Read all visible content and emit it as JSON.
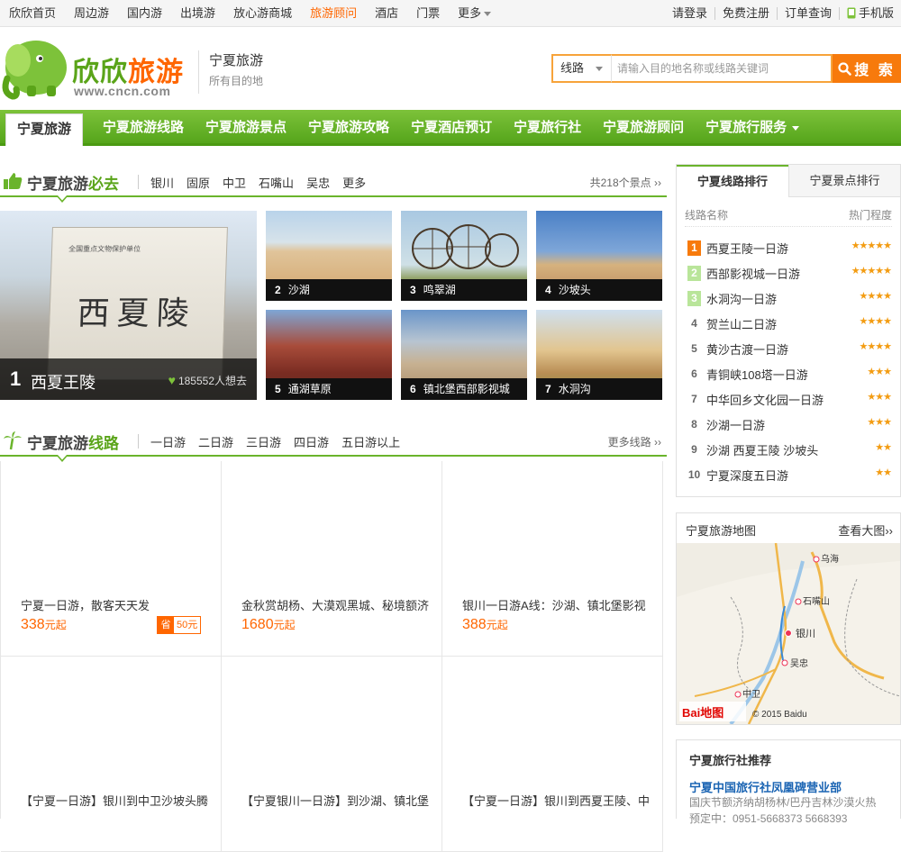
{
  "topbar": {
    "left": [
      "欣欣首页",
      "周边游",
      "国内游",
      "出境游",
      "放心游商城",
      "旅游顾问",
      "酒店",
      "门票",
      "更多"
    ],
    "active_index": 5,
    "right": [
      "请登录",
      "免费注册",
      "订单查询",
      "手机版"
    ]
  },
  "logo": {
    "name_a": "欣欣",
    "name_b": "旅游",
    "url": "www.cncn.com"
  },
  "city": {
    "title": "宁夏旅游",
    "subtitle": "所有目的地"
  },
  "search": {
    "select": "线路",
    "placeholder": "请输入目的地名称或线路关键词",
    "button": "搜 索"
  },
  "nav": [
    "宁夏旅游",
    "宁夏旅游线路",
    "宁夏旅游景点",
    "宁夏旅游攻略",
    "宁夏酒店预订",
    "宁夏旅行社",
    "宁夏旅游顾问",
    "宁夏旅行服务"
  ],
  "must_see": {
    "title_a": "宁夏旅游",
    "title_b": "必去",
    "tabs": [
      "银川",
      "固原",
      "中卫",
      "石嘴山",
      "吴忠",
      "更多"
    ],
    "more": "共218个景点",
    "big": {
      "rank": "1",
      "name": "西夏王陵",
      "hearts": "185552人想去",
      "stele_small": "全国重点文物保护单位",
      "stele_big": "西夏陵"
    },
    "thumbs": [
      {
        "rank": "2",
        "name": "沙湖"
      },
      {
        "rank": "3",
        "name": "鸣翠湖"
      },
      {
        "rank": "4",
        "name": "沙坡头"
      },
      {
        "rank": "5",
        "name": "通湖草原"
      },
      {
        "rank": "6",
        "name": "镇北堡西部影视城"
      },
      {
        "rank": "7",
        "name": "水洞沟"
      }
    ]
  },
  "routes_section": {
    "title_a": "宁夏旅游",
    "title_b": "线路",
    "tabs": [
      "一日游",
      "二日游",
      "三日游",
      "四日游",
      "五日游以上"
    ],
    "more": "更多线路",
    "items": [
      {
        "title": "宁夏一日游，散客天天发",
        "price": "338",
        "unit": "元起",
        "save_label": "省",
        "save_value": "50元"
      },
      {
        "title": "金秋赏胡杨、大漠观黑城、秘境额济",
        "price": "1680",
        "unit": "元起"
      },
      {
        "title": "银川一日游A线：沙湖、镇北堡影视",
        "price": "388",
        "unit": "元起"
      },
      {
        "title": "【宁夏一日游】银川到中卫沙坡头腾",
        "price": "",
        "unit": ""
      },
      {
        "title": "【宁夏银川一日游】到沙湖、镇北堡",
        "price": "",
        "unit": ""
      },
      {
        "title": "【宁夏一日游】银川到西夏王陵、中",
        "price": "",
        "unit": ""
      }
    ]
  },
  "ranking": {
    "tabs": [
      "宁夏线路排行",
      "宁夏景点排行"
    ],
    "col_name": "线路名称",
    "col_hot": "热门程度",
    "rows": [
      {
        "no": "1",
        "name": "西夏王陵一日游",
        "stars": "★★★★★"
      },
      {
        "no": "2",
        "name": "西部影视城一日游",
        "stars": "★★★★★"
      },
      {
        "no": "3",
        "name": "水洞沟一日游",
        "stars": "★★★★"
      },
      {
        "no": "4",
        "name": "贺兰山二日游",
        "stars": "★★★★"
      },
      {
        "no": "5",
        "name": "黄沙古渡一日游",
        "stars": "★★★★"
      },
      {
        "no": "6",
        "name": "青铜峡108塔一日游",
        "stars": "★★★"
      },
      {
        "no": "7",
        "name": "中华回乡文化园一日游",
        "stars": "★★★"
      },
      {
        "no": "8",
        "name": "沙湖一日游",
        "stars": "★★★"
      },
      {
        "no": "9",
        "name": "沙湖  西夏王陵  沙坡头",
        "stars": "★★"
      },
      {
        "no": "10",
        "name": "宁夏深度五日游",
        "stars": "★★"
      }
    ]
  },
  "map": {
    "title": "宁夏旅游地图",
    "more": "查看大图",
    "labels": [
      "乌海",
      "石嘴山",
      "银川",
      "吴忠",
      "中卫"
    ],
    "brand": "Bai地图",
    "copyright": "© 2015 Baidu"
  },
  "agency": {
    "title": "宁夏旅行社推荐",
    "name": "宁夏中国旅行社凤凰碑营业部",
    "desc": "国庆节额济纳胡杨林/巴丹吉林沙漠火热",
    "tel": "预定中：0951-5668373  5668393"
  },
  "colors": {
    "green": "#5aa419",
    "orange": "#f77a0c",
    "link": "#1a64b3"
  }
}
